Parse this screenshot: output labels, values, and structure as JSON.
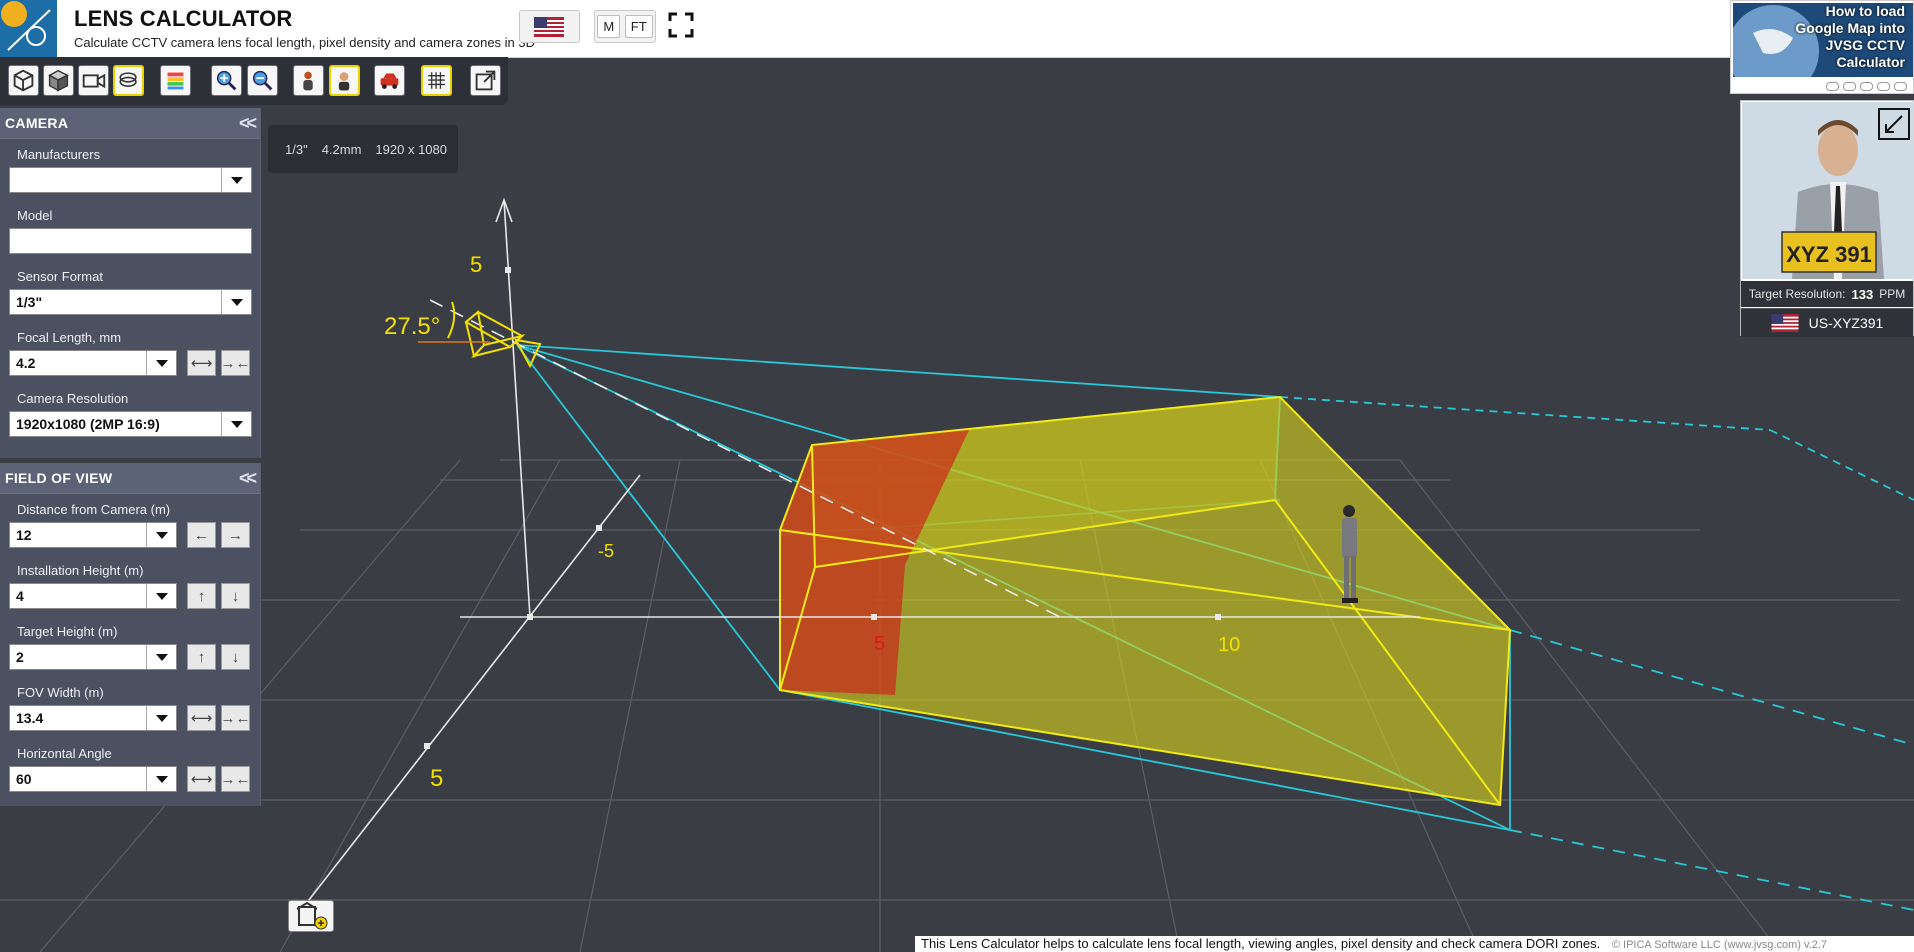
{
  "header": {
    "title": "LENS CALCULATOR",
    "subtitle": "Calculate CCTV camera lens focal length, pixel density and camera zones in 3D",
    "units": [
      "M",
      "FT"
    ]
  },
  "icons": {
    "logo": "lens-calculator-logo",
    "flag": "us-flag-icon",
    "fullscreen": "fullscreen-icon",
    "toolbar": [
      "cube-outline-icon",
      "cube-solid-icon",
      "camera-view-icon",
      "layers-icon",
      "color-zones-icon",
      "zoom-in-icon",
      "zoom-out-icon",
      "person-icon",
      "person-face-icon",
      "car-icon",
      "grid-icon",
      "share-icon"
    ],
    "home": "add-building-icon"
  },
  "camera_panel": {
    "title": "CAMERA",
    "fields": {
      "manufacturers": {
        "label": "Manufacturers",
        "value": ""
      },
      "model": {
        "label": "Model",
        "value": ""
      },
      "sensor_format": {
        "label": "Sensor Format",
        "value": "1/3\""
      },
      "focal_length": {
        "label": "Focal Length, mm",
        "value": "4.2"
      },
      "resolution": {
        "label": "Camera Resolution",
        "value": "1920x1080 (2MP 16:9)"
      }
    }
  },
  "fov_panel": {
    "title": "FIELD OF VIEW",
    "fields": {
      "distance": {
        "label": "Distance from Camera (m)",
        "value": "12"
      },
      "install_height": {
        "label": "Installation Height (m)",
        "value": "4"
      },
      "target_height": {
        "label": "Target Height (m)",
        "value": "2"
      },
      "fov_width": {
        "label": "FOV Width (m)",
        "value": "13.4"
      },
      "horizontal_angle": {
        "label": "Horizontal Angle",
        "value": "60"
      }
    }
  },
  "info_bar": {
    "sensor": "1/3\"",
    "focal": "4.2mm",
    "resolution": "1920 x 1080"
  },
  "scene": {
    "tilt_angle_label": "27.5°",
    "axis_labels": {
      "vertical_5": "5",
      "depth_neg5": "-5",
      "depth_5": "5",
      "axis_5": "5",
      "axis_10": "10"
    },
    "colors": {
      "fov": "#28c8d8",
      "zone_yellow": "#e8e21a",
      "zone_red": "#d81818",
      "axis": "#e8e8e8",
      "label": "#f2e000"
    }
  },
  "help_card": {
    "text": "How to load Google Map into JVSG CCTV Calculator"
  },
  "target_card": {
    "resolution_label": "Target Resolution:",
    "resolution_value": "133",
    "resolution_unit": "PPM",
    "plate_text": "US-XYZ391",
    "plate_image_text": "XYZ 391"
  },
  "footer": {
    "text": "This Lens Calculator helps to calculate lens focal length, viewing angles, pixel density and check camera DORI zones.",
    "copyright": "© IPICA Software LLC (www.jvsg.com) v.2.7"
  }
}
